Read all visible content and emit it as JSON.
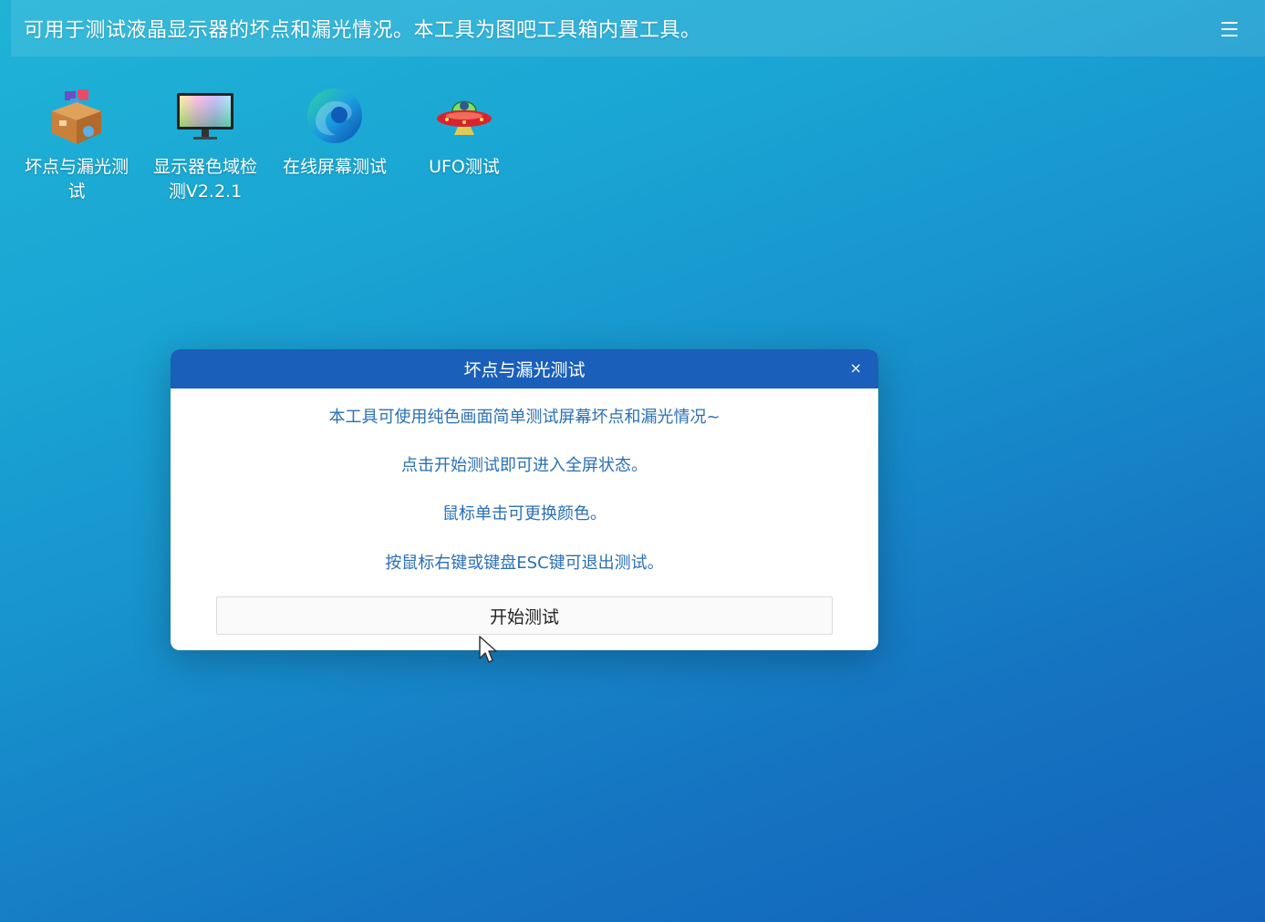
{
  "topbar": {
    "text": "可用于测试液晶显示器的坏点和漏光情况。本工具为图吧工具箱内置工具。",
    "menu_icon": "hamburger-menu-icon"
  },
  "desktop_icons": [
    {
      "label": "坏点与漏光测试",
      "icon": "toolbox-icon"
    },
    {
      "label": "显示器色域检测V2.2.1",
      "icon": "color-monitor-icon"
    },
    {
      "label": "在线屏幕测试",
      "icon": "edge-browser-icon"
    },
    {
      "label": "UFO测试",
      "icon": "ufo-icon"
    }
  ],
  "dialog": {
    "title": "坏点与漏光测试",
    "close_label": "×",
    "lines": [
      "本工具可使用纯色画面简单测试屏幕坏点和漏光情况~",
      "点击开始测试即可进入全屏状态。",
      "鼠标单击可更换颜色。",
      "按鼠标右键或键盘ESC键可退出测试。"
    ],
    "start_button": "开始测试"
  },
  "colors": {
    "dialog_header": "#1a5fb9",
    "dialog_text": "#2a6fb5"
  }
}
